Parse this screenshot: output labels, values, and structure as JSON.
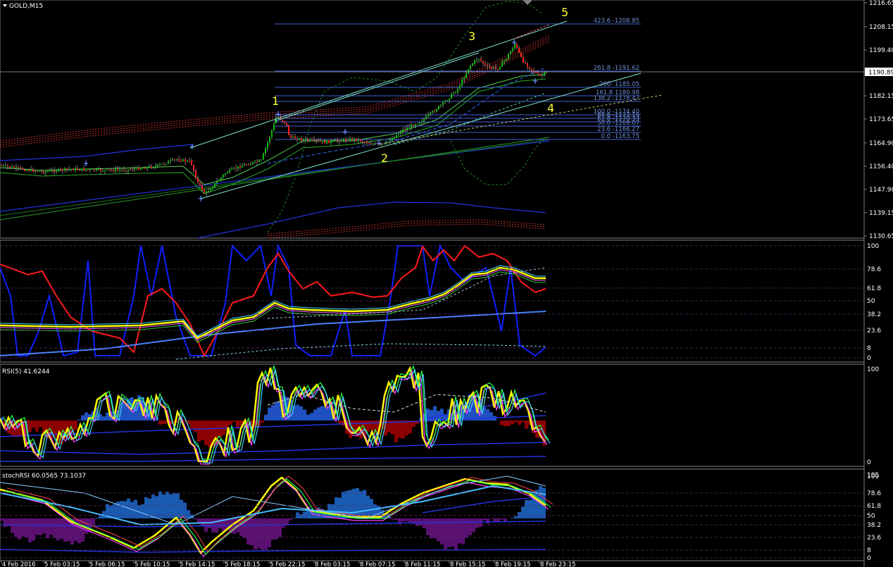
{
  "window": {
    "symbol_title": "GOLD,M15",
    "current_price": "1190.89"
  },
  "price_axis": [
    "1216.65",
    "1208.15",
    "1199.40",
    "1190.89",
    "1182.15",
    "1173.65",
    "1164.90",
    "1156.40",
    "1147.90",
    "1139.15",
    "1130.65"
  ],
  "fib_levels": [
    {
      "label": "423.6 -1208.85"
    },
    {
      "label": "261.8 -1191.62"
    },
    {
      "label": "200- 1185.05"
    },
    {
      "label": "161.8 1180.98"
    },
    {
      "label": "138.2 -1178.47"
    },
    {
      "label": "100.0 -1174.40"
    },
    {
      "label": "88.6 -1173.19"
    },
    {
      "label": "61.8 -1170.33"
    },
    {
      "label": "50.0 -1169.07"
    },
    {
      "label": "23.6 -1166.27"
    },
    {
      "label": "0.0 -1163.75"
    }
  ],
  "wave_labels": [
    "1",
    "2",
    "3",
    "4",
    "5"
  ],
  "panel2_axis": [
    "100",
    "78.6",
    "61.8",
    "50",
    "38.2",
    "23.6",
    "8",
    "0"
  ],
  "panel3": {
    "title": "RSI(5) 41.6244",
    "axis": [
      "100",
      "0"
    ]
  },
  "panel4": {
    "title": "stochRSI 60.0565 73.1037",
    "axis": [
      "105",
      "100",
      "78.6",
      "61.8",
      "50",
      "38.2",
      "23.6",
      "8",
      "0"
    ]
  },
  "time_axis": [
    "4 Feb 2016",
    "5 Feb 03:15",
    "5 Feb 06:15",
    "5 Feb 10:15",
    "5 Feb 14:15",
    "5 Feb 18:15",
    "5 Feb 22:15",
    "8 Feb 03:15",
    "8 Feb 07:15",
    "8 Feb 11:15",
    "8 Feb 15:15",
    "8 Feb 19:15",
    "8 Feb 23:15"
  ],
  "colors": {
    "bull": "#00c000",
    "bear": "#ff2020",
    "fib": "#4060d0",
    "wave": "#ffff33",
    "rsi": "#ffff00"
  }
}
